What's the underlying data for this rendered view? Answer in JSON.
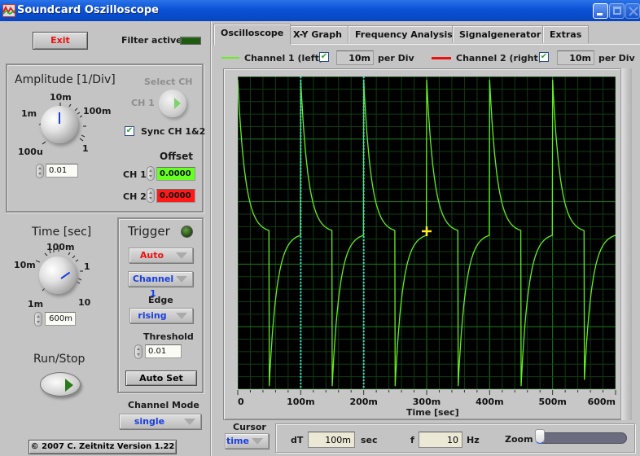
{
  "window": {
    "title": "Soundcard Oszilloscope",
    "controls": [
      "minimize",
      "maximize",
      "close"
    ]
  },
  "left_panel": {
    "exit_label": "Exit",
    "filter_label": "Filter active",
    "amplitude": {
      "title": "Amplitude [1/Div]",
      "scale_labels": [
        "100u",
        "1m",
        "10m",
        "100m",
        "1"
      ],
      "value": "0.01"
    },
    "select_ch": {
      "title": "Select CH",
      "channel_label": "CH 1"
    },
    "sync_label": "Sync CH 1&2",
    "sync_checked": true,
    "offset": {
      "title": "Offset",
      "ch1_label": "CH 1",
      "ch1_value": "0.0000",
      "ch1_color": "#66ff22",
      "ch2_label": "CH 2",
      "ch2_value": "0.0000",
      "ch2_color": "#ff1a1a"
    },
    "time": {
      "title": "Time [sec]",
      "scale_labels": [
        "1m",
        "10m",
        "100m",
        "1",
        "10"
      ],
      "value": "600m"
    },
    "trigger": {
      "title": "Trigger",
      "mode": "Auto",
      "mode_color": "#ee1111",
      "source": "Channel 1",
      "edge_label": "Edge",
      "edge": "rising",
      "threshold_label": "Threshold",
      "threshold": "0.01",
      "autoset_label": "Auto Set"
    },
    "run_stop_label": "Run/Stop",
    "channel_mode_label": "Channel Mode",
    "channel_mode": "single",
    "copyright": "© 2007   C. Zeitnitz Version 1.22"
  },
  "tabs": [
    {
      "label": "Oscilloscope",
      "active": true
    },
    {
      "label": "X-Y Graph",
      "active": false
    },
    {
      "label": "Frequency Analysis",
      "active": false
    },
    {
      "label": "Signalgenerator",
      "active": false
    },
    {
      "label": "Extras",
      "active": false
    }
  ],
  "channels": {
    "ch1": {
      "label": "Channel 1 (left)",
      "checked": true,
      "per_div_value": "10m",
      "per_div_unit": "per Div",
      "color": "#66ee22"
    },
    "ch2": {
      "label": "Channel 2 (right)",
      "checked": true,
      "per_div_value": "10m",
      "per_div_unit": "per Div",
      "color": "#ee1111"
    }
  },
  "cursor": {
    "label": "Cursor",
    "mode": "time",
    "dT_label": "dT",
    "dT_value": "100m",
    "dT_unit": "sec",
    "f_label": "f",
    "f_value": "10",
    "f_unit": "Hz",
    "zoom_label": "Zoom",
    "zoom_level": 0
  },
  "chart_data": {
    "type": "line",
    "title": "",
    "xlabel": "Time [sec]",
    "ylabel": "",
    "x_tick_labels": [
      "0",
      "100m",
      "200m",
      "300m",
      "400m",
      "500m",
      "600m"
    ],
    "xlim": [
      0,
      0.6
    ],
    "ylim": [
      -5,
      5
    ],
    "grid": true,
    "divisions": {
      "x": 6,
      "y": 5,
      "minor_per_major": 5
    },
    "series": [
      {
        "name": "Channel 1 (left)",
        "color": "#66ee22",
        "shape": "differentiated square wave",
        "period": 0.1,
        "rising_edges": [
          0,
          0.1,
          0.2,
          0.3,
          0.4,
          0.5
        ],
        "falling_edges": [
          0.05,
          0.15,
          0.25,
          0.35,
          0.45,
          0.55
        ],
        "peak_divisions": 2.45,
        "trough_divisions": -2.45,
        "baseline_divisions": 0
      }
    ],
    "cursors_x": [
      0.1,
      0.2
    ],
    "cursor_color": "#33dddd",
    "marker": {
      "x": 0.3,
      "y": 0.0,
      "color": "#ffee22"
    }
  }
}
